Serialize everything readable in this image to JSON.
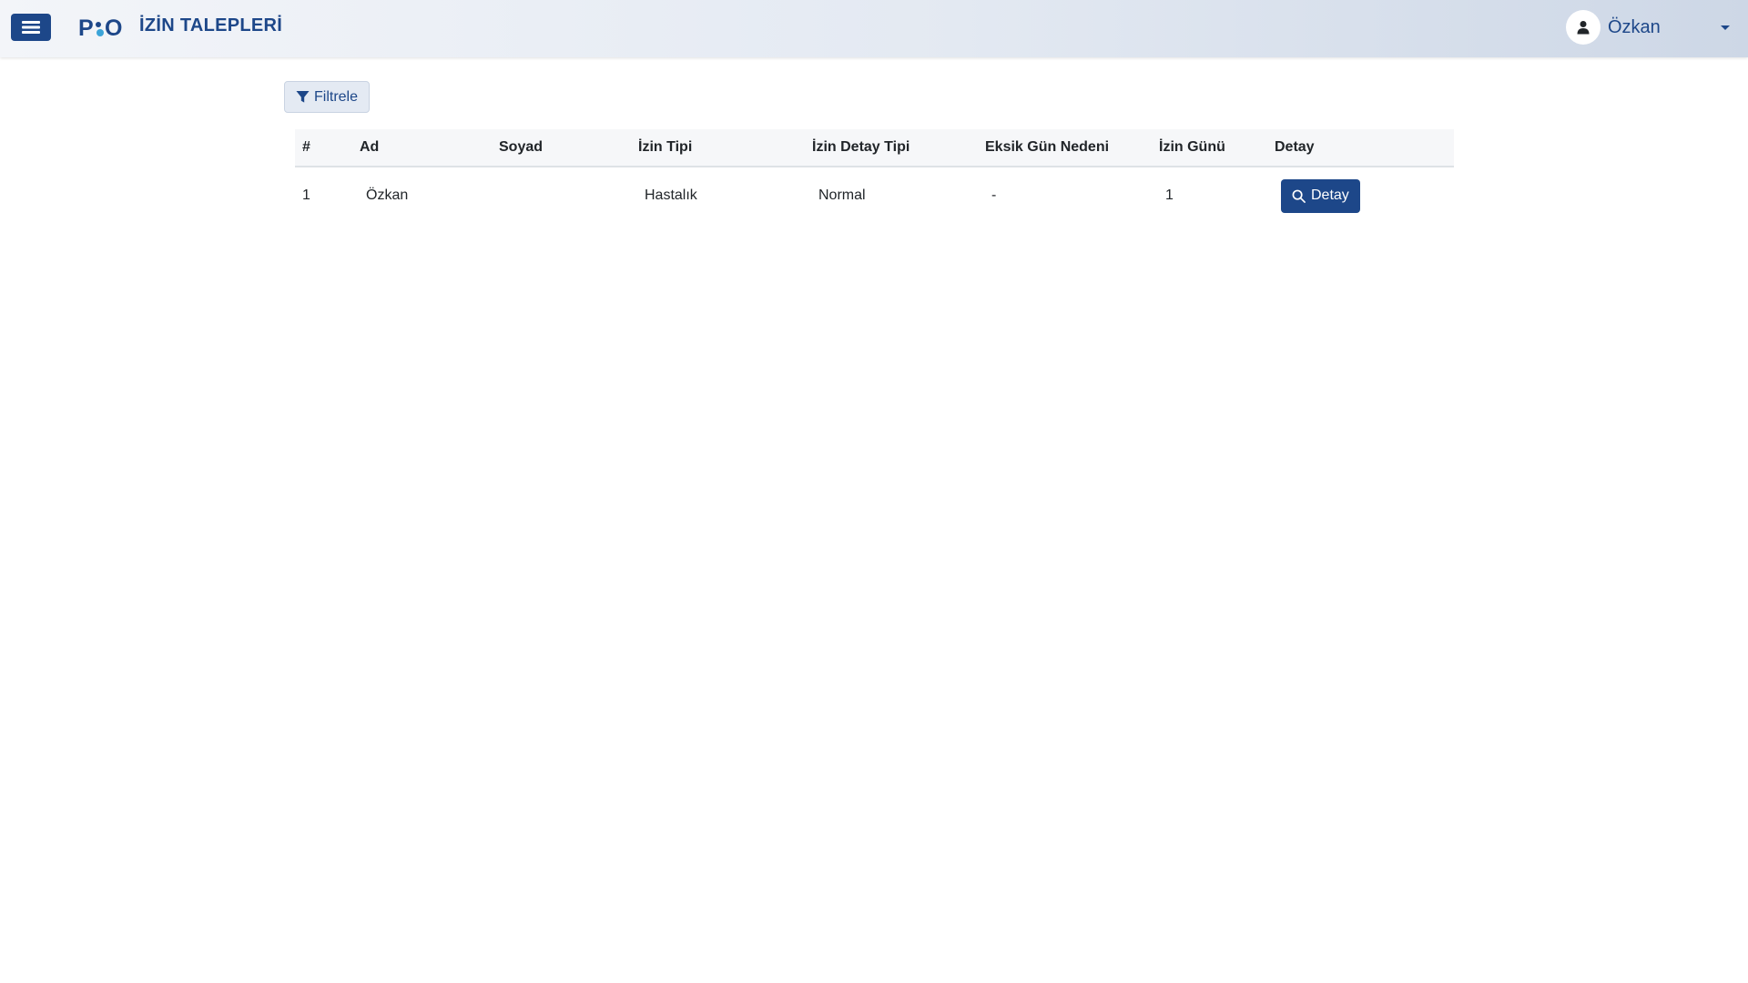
{
  "header": {
    "logo_text": "PIO",
    "title": "İZİN TALEPLERİ",
    "user_name": "Özkan"
  },
  "toolbar": {
    "filter_label": "Filtrele"
  },
  "table": {
    "columns": [
      "#",
      "Ad",
      "Soyad",
      "İzin Tipi",
      "İzin Detay Tipi",
      "Eksik Gün Nedeni",
      "İzin Günü",
      "Detay"
    ],
    "rows": [
      {
        "index": "1",
        "ad": "Özkan",
        "soyad": "",
        "izin_tipi": "Hastalık",
        "izin_detay_tipi": "Normal",
        "eksik_gun_nedeni": "-",
        "izin_gunu": "1",
        "detay_label": "Detay"
      }
    ]
  },
  "colors": {
    "primary": "#1d4789",
    "logo_dot": "#3ba4d8"
  },
  "icons": {
    "menu": "hamburger-icon",
    "user": "user-icon",
    "filter": "filter-icon",
    "detail": "search-icon"
  }
}
